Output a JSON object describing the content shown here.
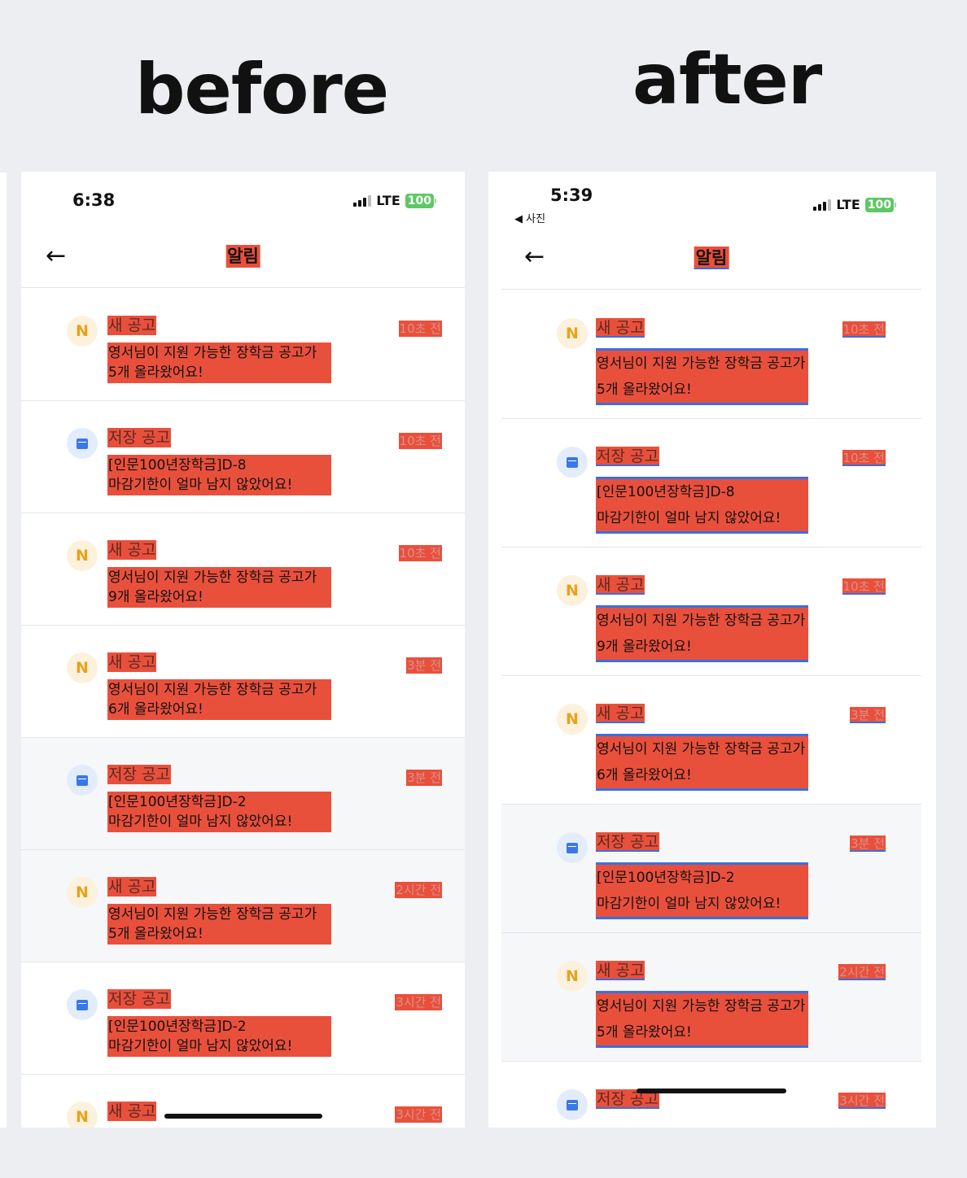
{
  "labels": {
    "before": "before",
    "after": "after"
  },
  "before": {
    "status": {
      "time": "6:38",
      "network": "LTE",
      "battery": "100"
    },
    "header": {
      "title": "알림",
      "back_icon": "arrow-left-icon"
    },
    "items": [
      {
        "kind": "new",
        "icon_text": "N",
        "type": "새 공고",
        "line1": "영서님이 지원 가능한 장학금 공고가",
        "line2": "5개 올라왔어요!",
        "time": "10초 전",
        "read": false
      },
      {
        "kind": "saved",
        "icon_text": "",
        "type": "저장 공고",
        "line1": "[인문100년장학금]D-8",
        "line2": "마감기한이 얼마 남지 않았어요!",
        "time": "10초 전",
        "read": false
      },
      {
        "kind": "new",
        "icon_text": "N",
        "type": "새 공고",
        "line1": "영서님이 지원 가능한 장학금 공고가",
        "line2": "9개 올라왔어요!",
        "time": "10초 전",
        "read": false
      },
      {
        "kind": "new",
        "icon_text": "N",
        "type": "새 공고",
        "line1": "영서님이 지원 가능한 장학금 공고가",
        "line2": "6개 올라왔어요!",
        "time": "3분 전",
        "read": false
      },
      {
        "kind": "saved",
        "icon_text": "",
        "type": "저장 공고",
        "line1": "[인문100년장학금]D-2",
        "line2": "마감기한이 얼마 남지 않았어요!",
        "time": "3분 전",
        "read": true
      },
      {
        "kind": "new",
        "icon_text": "N",
        "type": "새 공고",
        "line1": "영서님이 지원 가능한 장학금 공고가",
        "line2": "5개 올라왔어요!",
        "time": "2시간 전",
        "read": true
      },
      {
        "kind": "saved",
        "icon_text": "",
        "type": "저장 공고",
        "line1": "[인문100년장학금]D-2",
        "line2": "마감기한이 얼마 남지 않았어요!",
        "time": "3시간 전",
        "read": false
      },
      {
        "kind": "new",
        "icon_text": "N",
        "type": "새 공고",
        "line1": "",
        "line2": "",
        "time": "3시간 전",
        "read": false
      }
    ]
  },
  "after": {
    "status": {
      "time": "5:39",
      "back_link": "◀ 사진",
      "network": "LTE",
      "battery": "100"
    },
    "header": {
      "title": "알림",
      "back_icon": "arrow-left-icon"
    },
    "items": [
      {
        "kind": "new",
        "icon_text": "N",
        "type": "새 공고",
        "line1": "영서님이 지원 가능한 장학금 공고가",
        "line2": "5개 올라왔어요!",
        "time": "10초 전",
        "read": false
      },
      {
        "kind": "saved",
        "icon_text": "",
        "type": "저장 공고",
        "line1": "[인문100년장학금]D-8",
        "line2": "마감기한이 얼마 남지 않았어요!",
        "time": "10초 전",
        "read": false
      },
      {
        "kind": "new",
        "icon_text": "N",
        "type": "새 공고",
        "line1": "영서님이 지원 가능한 장학금 공고가",
        "line2": "9개 올라왔어요!",
        "time": "10초 전",
        "read": false
      },
      {
        "kind": "new",
        "icon_text": "N",
        "type": "새 공고",
        "line1": "영서님이 지원 가능한 장학금 공고가",
        "line2": "6개 올라왔어요!",
        "time": "3분 전",
        "read": false
      },
      {
        "kind": "saved",
        "icon_text": "",
        "type": "저장 공고",
        "line1": "[인문100년장학금]D-2",
        "line2": "마감기한이 얼마 남지 않았어요!",
        "time": "3분 전",
        "read": true
      },
      {
        "kind": "new",
        "icon_text": "N",
        "type": "새 공고",
        "line1": "영서님이 지원 가능한 장학금 공고가",
        "line2": "5개 올라왔어요!",
        "time": "2시간 전",
        "read": true
      },
      {
        "kind": "saved",
        "icon_text": "",
        "type": "저장 공고",
        "line1": "",
        "line2": "",
        "time": "3시간 전",
        "read": false
      }
    ]
  }
}
